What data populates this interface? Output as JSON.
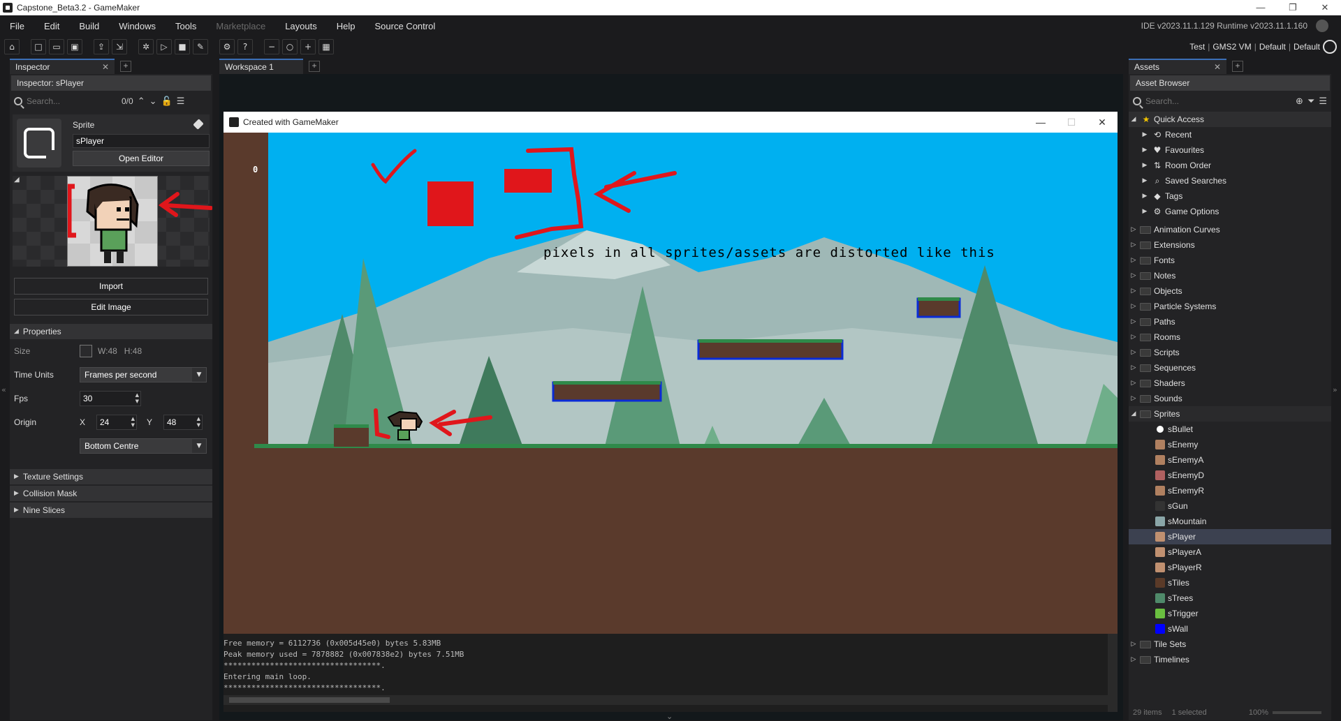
{
  "window": {
    "title": "Capstone_Beta3.2 - GameMaker",
    "controls": [
      "—",
      "❐",
      "✕"
    ]
  },
  "menu": {
    "items": [
      "File",
      "Edit",
      "Build",
      "Windows",
      "Tools",
      "Marketplace",
      "Layouts",
      "Help",
      "Source Control"
    ],
    "disabled": [
      "Marketplace"
    ],
    "ide_version": "IDE v2023.11.1.129  Runtime v2023.11.1.160"
  },
  "target": {
    "config": "Test",
    "vm": "GMS2 VM",
    "device": "Default",
    "config2": "Default"
  },
  "inspector": {
    "tab": "Inspector",
    "header": "Inspector: sPlayer",
    "search_placeholder": "Search...",
    "search_count": "0/0",
    "sprite_label": "Sprite",
    "sprite_name": "sPlayer",
    "open_editor": "Open Editor",
    "import": "Import",
    "edit_image": "Edit Image",
    "properties": {
      "title": "Properties",
      "size_label": "Size",
      "width": "W:48",
      "height": "H:48",
      "time_units_label": "Time Units",
      "time_units": "Frames per second",
      "fps_label": "Fps",
      "fps": "30",
      "origin_label": "Origin",
      "origin_x_label": "X",
      "origin_x": "24",
      "origin_y_label": "Y",
      "origin_y": "48",
      "origin_preset": "Bottom Centre"
    },
    "sections": [
      "Texture Settings",
      "Collision Mask",
      "Nine Slices"
    ]
  },
  "workspace": {
    "tab": "Workspace 1"
  },
  "game_window": {
    "title": "Created with GameMaker",
    "score": "0",
    "annotation": "pixels in all sprites/assets are distorted like this",
    "console": [
      "Free memory = 6112736 (0x005d45e0) bytes 5.83MB",
      "Peak memory used = 7878882 (0x007838e2) bytes 7.51MB",
      "**********************************.",
      "Entering main loop.",
      "**********************************."
    ]
  },
  "assets": {
    "tab": "Assets",
    "header": "Asset Browser",
    "search_placeholder": "Search...",
    "quick_access": {
      "label": "Quick Access",
      "items": [
        {
          "label": "Recent",
          "icon": "recent-icon",
          "glyph": "⟲"
        },
        {
          "label": "Favourites",
          "icon": "heart-icon",
          "glyph": "♥"
        },
        {
          "label": "Room Order",
          "icon": "room-order-icon",
          "glyph": "⇅"
        },
        {
          "label": "Saved Searches",
          "icon": "search-icon",
          "glyph": "⌕"
        },
        {
          "label": "Tags",
          "icon": "tag-icon",
          "glyph": "◆"
        },
        {
          "label": "Game Options",
          "icon": "gear-icon",
          "glyph": "⚙"
        }
      ]
    },
    "folders_top": [
      "Animation Curves",
      "Extensions",
      "Fonts",
      "Notes",
      "Objects",
      "Particle Systems",
      "Paths",
      "Rooms",
      "Scripts",
      "Sequences",
      "Shaders",
      "Sounds"
    ],
    "sprites_folder": "Sprites",
    "sprites": [
      {
        "name": "sBullet",
        "color": "#ffffff"
      },
      {
        "name": "sEnemy",
        "color": "#b08060"
      },
      {
        "name": "sEnemyA",
        "color": "#b08060"
      },
      {
        "name": "sEnemyD",
        "color": "#b06060"
      },
      {
        "name": "sEnemyR",
        "color": "#b08060"
      },
      {
        "name": "sGun",
        "color": "#333333"
      },
      {
        "name": "sMountain",
        "color": "#8aa6a8"
      },
      {
        "name": "sPlayer",
        "color": "#c09070"
      },
      {
        "name": "sPlayerA",
        "color": "#c09070"
      },
      {
        "name": "sPlayerR",
        "color": "#c09070"
      },
      {
        "name": "sTiles",
        "color": "#5a3a28"
      },
      {
        "name": "sTrees",
        "color": "#4f8a6a"
      },
      {
        "name": "sTrigger",
        "color": "#6abf40"
      },
      {
        "name": "sWall",
        "color": "#0000ff"
      }
    ],
    "selected": "sPlayer",
    "folders_bottom": [
      "Tile Sets",
      "Timelines"
    ],
    "footer_items": "29 items",
    "footer_selected": "1 selected",
    "zoom": "100%"
  },
  "colors": {
    "sky": "#00b0f0",
    "annotation_red": "#e0161b",
    "platform_outline": "#0a2bd6"
  }
}
